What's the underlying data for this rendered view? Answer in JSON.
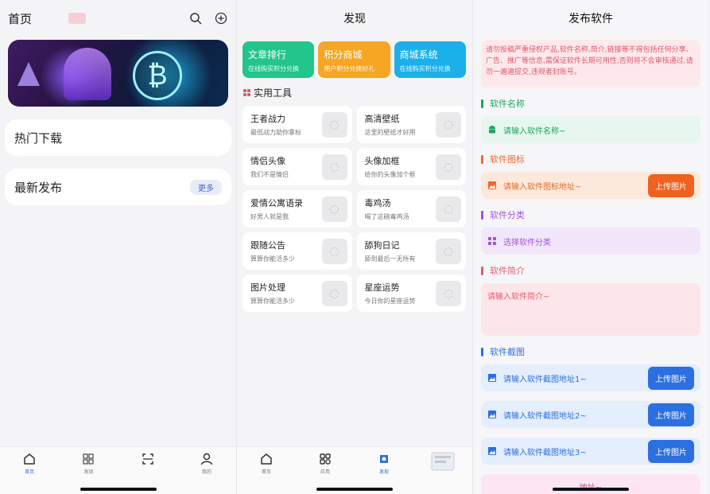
{
  "home": {
    "title": "首页",
    "sections": [
      {
        "label": "热门下载",
        "action": ""
      },
      {
        "label": "最新发布",
        "action": "更多"
      }
    ],
    "tabs": [
      {
        "label": "首页",
        "icon": "home-icon"
      },
      {
        "label": "发现",
        "icon": "apps-icon"
      },
      {
        "label": "",
        "icon": "scan-icon"
      },
      {
        "label": "我的",
        "icon": "user-icon"
      }
    ]
  },
  "discover": {
    "title": "发现",
    "promos": [
      {
        "title": "文章排行",
        "sub": "在线购买积分兑换",
        "color": "#22c58b"
      },
      {
        "title": "积分商城",
        "sub": "用户积分兑换好礼",
        "color": "#f6a623"
      },
      {
        "title": "商城系统",
        "sub": "在线购买积分兑换",
        "color": "#1bb0ea"
      }
    ],
    "tools_title": "实用工具",
    "tools": [
      {
        "title": "王者战力",
        "sub": "最低战力助你拿标"
      },
      {
        "title": "高清壁纸",
        "sub": "这里的壁纸才好用"
      },
      {
        "title": "情侣头像",
        "sub": "我们不是情侣"
      },
      {
        "title": "头像加框",
        "sub": "给你的头像加个框"
      },
      {
        "title": "爱情公寓语录",
        "sub": "好男人就是我"
      },
      {
        "title": "毒鸡汤",
        "sub": "喝了这碗毒鸡汤"
      },
      {
        "title": "跟随公告",
        "sub": "算算你能活多少"
      },
      {
        "title": "舔狗日记",
        "sub": "舔到最后一无所有"
      },
      {
        "title": "图片处理",
        "sub": "算算你能活多少"
      },
      {
        "title": "星座运势",
        "sub": "今日你的星座运势"
      }
    ],
    "tabs": [
      {
        "label": "首页",
        "icon": "home-icon"
      },
      {
        "label": "应用",
        "icon": "apps-icon"
      },
      {
        "label": "发现",
        "icon": "discover-icon"
      },
      {
        "label": "",
        "icon": "image-icon"
      }
    ]
  },
  "publish": {
    "title": "发布软件",
    "notice": "请勿投稿严重侵权产品,软件名称,简介,链接等不得包括任何分享、广告、推广等信息,需保证软件长期可用性,否则将不会审核通过,请勿一遍遍提交,违规者封账号。",
    "fields": [
      {
        "heading": "软件名称",
        "placeholder": "请输入软件名称~",
        "accent": "#1fa463",
        "bg": "#e7f6ee",
        "icon": "android-icon",
        "upload": ""
      },
      {
        "heading": "软件图标",
        "placeholder": "请输入软件图标地址~",
        "accent": "#f06a2a",
        "bg": "#fde9dc",
        "icon": "image-icon",
        "upload": "上传图片"
      },
      {
        "heading": "软件分类",
        "placeholder": "选择软件分类",
        "accent": "#a255d6",
        "bg": "#f2e6fb",
        "icon": "grid-icon",
        "upload": ""
      },
      {
        "heading": "软件简介",
        "placeholder": "请输入软件简介~",
        "accent": "#e65a6e",
        "bg": "#fde6ea",
        "icon": "",
        "upload": ""
      },
      {
        "heading": "软件截图",
        "placeholder": "请输入软件截图地址1~",
        "accent": "#2c6fe0",
        "bg": "#e5eefc",
        "icon": "image-icon",
        "upload": "上传图片"
      }
    ],
    "screens": [
      {
        "placeholder": "请输入软件截图地址2~",
        "upload": "上传图片"
      },
      {
        "placeholder": "请输入软件截图地址3~",
        "upload": "上传图片"
      }
    ],
    "bottom_hint": "地址~"
  }
}
